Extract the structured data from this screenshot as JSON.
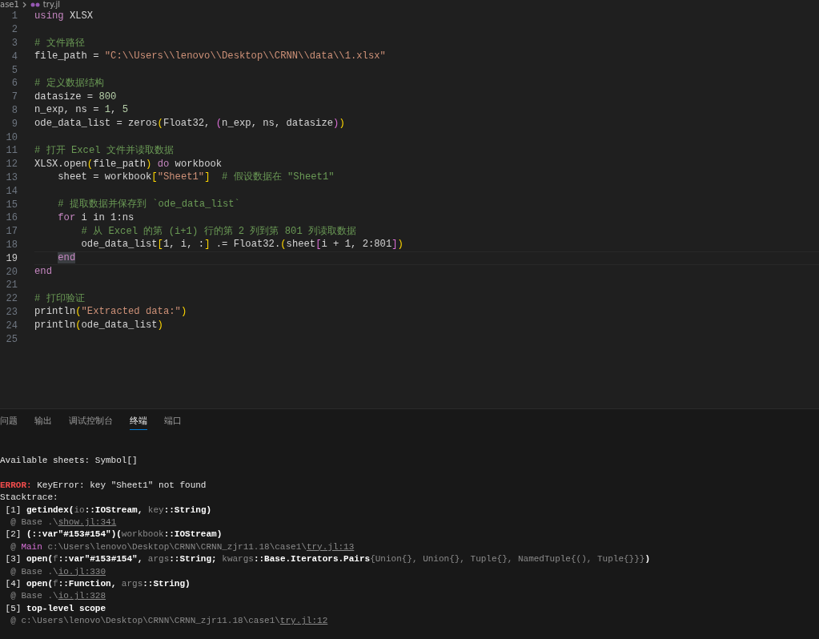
{
  "breadcrumb": {
    "folder": "ase1",
    "file": "try.jl"
  },
  "editor": {
    "lines": [
      {
        "number": "1",
        "current": false,
        "tokens": [
          {
            "kind": "keyword",
            "text": "using"
          },
          {
            "kind": "plain",
            "text": " XLSX"
          }
        ]
      },
      {
        "number": "2",
        "current": false
      },
      {
        "number": "3",
        "current": false,
        "tokens": [
          {
            "kind": "comment",
            "text": "# 文件路径"
          }
        ]
      },
      {
        "number": "4",
        "current": false,
        "tokens": [
          {
            "kind": "plain",
            "text": "file_path = "
          },
          {
            "kind": "string",
            "text": "\"C:\\\\Users\\\\lenovo\\\\Desktop\\\\CRNN\\\\data\\\\1.xlsx\""
          }
        ]
      },
      {
        "number": "5",
        "current": false
      },
      {
        "number": "6",
        "current": false,
        "tokens": [
          {
            "kind": "comment",
            "text": "# 定义数据结构"
          }
        ]
      },
      {
        "number": "7",
        "current": false,
        "tokens": [
          {
            "kind": "plain",
            "text": "datasize = "
          },
          {
            "kind": "number",
            "text": "800"
          }
        ]
      },
      {
        "number": "8",
        "current": false,
        "tokens": [
          {
            "kind": "plain",
            "text": "n_exp, ns = "
          },
          {
            "kind": "number",
            "text": "1"
          },
          {
            "kind": "plain",
            "text": ", "
          },
          {
            "kind": "number",
            "text": "5"
          }
        ]
      },
      {
        "number": "9",
        "current": false,
        "tokens": [
          {
            "kind": "plain",
            "text": "ode_data_list = zeros"
          },
          {
            "kind": "bracket1",
            "text": "("
          },
          {
            "kind": "plain",
            "text": "Float32, "
          },
          {
            "kind": "bracket2",
            "text": "("
          },
          {
            "kind": "plain",
            "text": "n_exp, ns, datasize"
          },
          {
            "kind": "bracket2",
            "text": ")"
          },
          {
            "kind": "bracket1",
            "text": ")"
          }
        ]
      },
      {
        "number": "10",
        "current": false
      },
      {
        "number": "11",
        "current": false,
        "tokens": [
          {
            "kind": "comment",
            "text": "# 打开 Excel 文件并读取数据"
          }
        ]
      },
      {
        "number": "12",
        "current": false,
        "tokens": [
          {
            "kind": "plain",
            "text": "XLSX.open"
          },
          {
            "kind": "bracket1",
            "text": "("
          },
          {
            "kind": "plain",
            "text": "file_path"
          },
          {
            "kind": "bracket1",
            "text": ")"
          },
          {
            "kind": "keyword",
            "text": " do"
          },
          {
            "kind": "plain",
            "text": " workbook"
          }
        ]
      },
      {
        "number": "13",
        "current": false,
        "tokens": [
          {
            "kind": "plain",
            "text": "    sheet = workbook"
          },
          {
            "kind": "bracket1",
            "text": "["
          },
          {
            "kind": "string",
            "text": "\"Sheet1\""
          },
          {
            "kind": "bracket1",
            "text": "]"
          },
          {
            "kind": "comment",
            "text": "  # 假设数据在 \"Sheet1\""
          }
        ]
      },
      {
        "number": "14",
        "current": false
      },
      {
        "number": "15",
        "current": false,
        "tokens": [
          {
            "kind": "comment",
            "text": "    # 提取数据并保存到 `ode_data_list`"
          }
        ]
      },
      {
        "number": "16",
        "current": false,
        "tokens": [
          {
            "kind": "keyword",
            "text": "    for"
          },
          {
            "kind": "plain",
            "text": " i in 1:ns"
          }
        ]
      },
      {
        "number": "17",
        "current": false,
        "tokens": [
          {
            "kind": "comment",
            "text": "        # 从 Excel 的第 (i+1) 行的第 2 列到第 801 列读取数据"
          }
        ]
      },
      {
        "number": "18",
        "current": false,
        "tokens": [
          {
            "kind": "plain",
            "text": "        ode_data_list"
          },
          {
            "kind": "bracket1",
            "text": "["
          },
          {
            "kind": "plain",
            "text": "1, i, :"
          },
          {
            "kind": "bracket1",
            "text": "]"
          },
          {
            "kind": "plain",
            "text": " .= Float32."
          },
          {
            "kind": "bracket1",
            "text": "("
          },
          {
            "kind": "plain",
            "text": "sheet"
          },
          {
            "kind": "bracket2",
            "text": "["
          },
          {
            "kind": "plain",
            "text": "i + 1, 2:801"
          },
          {
            "kind": "bracket2",
            "text": "]"
          },
          {
            "kind": "bracket1",
            "text": ")"
          }
        ]
      },
      {
        "number": "19",
        "current": true,
        "tokens": [
          {
            "kind": "keyword",
            "text": "    end"
          }
        ]
      },
      {
        "number": "20",
        "current": false,
        "tokens": [
          {
            "kind": "keyword",
            "text": "end"
          }
        ]
      },
      {
        "number": "21",
        "current": false
      },
      {
        "number": "22",
        "current": false,
        "tokens": [
          {
            "kind": "comment",
            "text": "# 打印验证"
          }
        ]
      },
      {
        "number": "23",
        "current": false,
        "tokens": [
          {
            "kind": "plain",
            "text": "println"
          },
          {
            "kind": "bracket1",
            "text": "("
          },
          {
            "kind": "string",
            "text": "\"Extracted data:\""
          },
          {
            "kind": "bracket1",
            "text": ")"
          }
        ]
      },
      {
        "number": "24",
        "current": false,
        "tokens": [
          {
            "kind": "plain",
            "text": "println"
          },
          {
            "kind": "bracket1",
            "text": "("
          },
          {
            "kind": "plain",
            "text": "ode_data_list"
          },
          {
            "kind": "bracket1",
            "text": ")"
          }
        ]
      },
      {
        "number": "25",
        "current": false
      }
    ]
  },
  "panel": {
    "tabs": [
      {
        "label": "问题",
        "selected": false
      },
      {
        "label": "输出",
        "selected": false
      },
      {
        "label": "调试控制台",
        "selected": false
      },
      {
        "label": "终端",
        "selected": true
      },
      {
        "label": "端口",
        "selected": false
      }
    ],
    "terminal": [
      {
        "tokens": [
          {
            "kind": "text",
            "text": "Available sheets: Symbol[]"
          }
        ]
      },
      {
        "tokens": [
          {
            "kind": "error",
            "text": "ERROR:"
          },
          {
            "kind": "text",
            "text": " KeyError: key \"Sheet1\" not found"
          }
        ]
      },
      {
        "tokens": [
          {
            "kind": "text",
            "text": "Stacktrace:"
          }
        ]
      },
      {
        "tokens": [
          {
            "kind": "text",
            "text": " [1] "
          },
          {
            "kind": "strong",
            "text": "getindex("
          },
          {
            "kind": "dim",
            "text": "io"
          },
          {
            "kind": "strong",
            "text": "::IOStream, "
          },
          {
            "kind": "dim",
            "text": "key"
          },
          {
            "kind": "strong",
            "text": "::String)"
          }
        ]
      },
      {
        "tokens": [
          {
            "kind": "dim",
            "text": "  @ Base .\\"
          },
          {
            "kind": "link",
            "text": "show.jl:341"
          }
        ]
      },
      {
        "tokens": [
          {
            "kind": "text",
            "text": " [2] "
          },
          {
            "kind": "strong",
            "text": "(::var\"#153#154\")("
          },
          {
            "kind": "dim",
            "text": "workbook"
          },
          {
            "kind": "strong",
            "text": "::IOStream)"
          }
        ]
      },
      {
        "tokens": [
          {
            "kind": "dim",
            "text": "  @ "
          },
          {
            "kind": "module",
            "text": "Main"
          },
          {
            "kind": "dim",
            "text": " c:\\Users\\lenovo\\Desktop\\CRNN\\CRNN_zjr11.18\\case1\\"
          },
          {
            "kind": "link",
            "text": "try.jl:13"
          }
        ]
      },
      {
        "tokens": [
          {
            "kind": "text",
            "text": " [3] "
          },
          {
            "kind": "strong",
            "text": "open("
          },
          {
            "kind": "dim",
            "text": "f"
          },
          {
            "kind": "strong",
            "text": "::var\"#153#154\", "
          },
          {
            "kind": "dim",
            "text": "args"
          },
          {
            "kind": "strong",
            "text": "::String; "
          },
          {
            "kind": "dim",
            "text": "kwargs"
          },
          {
            "kind": "strong",
            "text": "::Base.Iterators.Pairs"
          },
          {
            "kind": "dim",
            "text": "{Union{}, Union{}, Tuple{}, NamedTuple{(), Tuple{}}}"
          },
          {
            "kind": "strong",
            "text": ")"
          }
        ]
      },
      {
        "tokens": [
          {
            "kind": "dim",
            "text": "  @ Base .\\"
          },
          {
            "kind": "link",
            "text": "io.jl:330"
          }
        ]
      },
      {
        "tokens": [
          {
            "kind": "text",
            "text": " [4] "
          },
          {
            "kind": "strong",
            "text": "open("
          },
          {
            "kind": "dim",
            "text": "f"
          },
          {
            "kind": "strong",
            "text": "::Function, "
          },
          {
            "kind": "dim",
            "text": "args"
          },
          {
            "kind": "strong",
            "text": "::String)"
          }
        ]
      },
      {
        "tokens": [
          {
            "kind": "dim",
            "text": "  @ Base .\\"
          },
          {
            "kind": "link",
            "text": "io.jl:328"
          }
        ]
      },
      {
        "tokens": [
          {
            "kind": "text",
            "text": " [5] "
          },
          {
            "kind": "strong",
            "text": "top-level scope"
          }
        ]
      },
      {
        "tokens": [
          {
            "kind": "dim",
            "text": "  @ c:\\Users\\lenovo\\Desktop\\CRNN\\CRNN_zjr11.18\\case1\\"
          },
          {
            "kind": "link",
            "text": "try.jl:12"
          }
        ]
      }
    ]
  }
}
